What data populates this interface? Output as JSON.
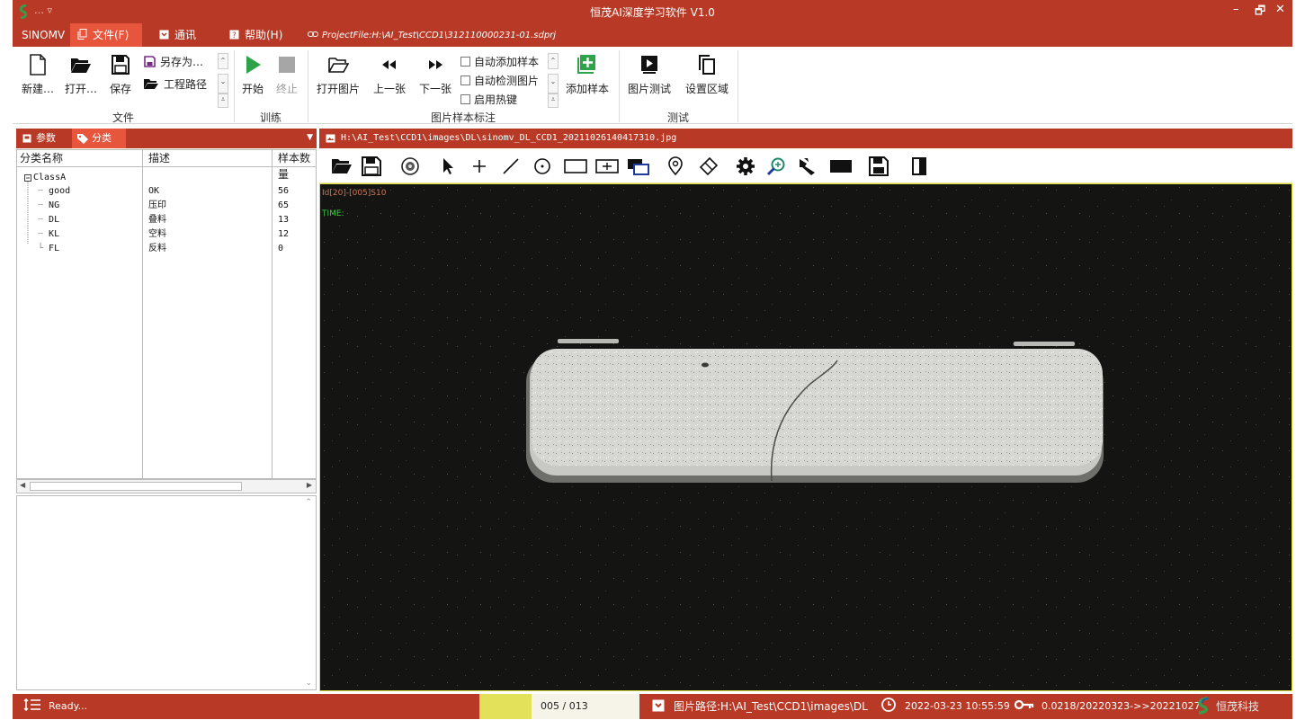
{
  "app": {
    "title": "恒茂AI深度学习软件 V1.0",
    "quick_access": "…   ▿",
    "window_controls": {
      "minimize": "–",
      "restore": "🗗",
      "close": "✕"
    }
  },
  "menu": {
    "brand": "SINOMV",
    "items": [
      {
        "label": "文件(F)",
        "icon": "copy-icon"
      },
      {
        "label": "通讯",
        "icon": "comm-icon"
      },
      {
        "label": "帮助(H)",
        "icon": "help-icon"
      }
    ],
    "project_file": "ProjectFile:H:\\AI_Test\\CCD1\\312110000231-01.sdprj"
  },
  "ribbon": {
    "file_group": {
      "label": "文件",
      "new": "新建…",
      "open": "打开…",
      "save": "保存",
      "save_as": "另存为…",
      "project_path": "工程路径"
    },
    "train_group": {
      "label": "训练",
      "start": "开始",
      "stop": "终止"
    },
    "annotate_group": {
      "label": "图片样本标注",
      "open_image": "打开图片",
      "prev": "上一张",
      "next": "下一张",
      "auto_add": "自动添加样本",
      "auto_detect": "自动检测图片",
      "hotkey": "启用热键",
      "add_sample": "添加样本"
    },
    "test_group": {
      "label": "测试",
      "image_test": "图片测试",
      "set_region": "设置区域"
    }
  },
  "left_panel": {
    "tabs": [
      {
        "label": "参数"
      },
      {
        "label": "分类"
      }
    ],
    "columns": [
      "分类名称",
      "描述",
      "样本数量"
    ],
    "root": "ClassA",
    "rows": [
      {
        "name": "good",
        "desc": "OK",
        "count": "56"
      },
      {
        "name": "NG",
        "desc": "压印",
        "count": "65"
      },
      {
        "name": "DL",
        "desc": "叠料",
        "count": "13"
      },
      {
        "name": "KL",
        "desc": "空料",
        "count": "12"
      },
      {
        "name": "FL",
        "desc": "反料",
        "count": "0"
      }
    ]
  },
  "viewer": {
    "path": "H:\\AI_Test\\CCD1\\images\\DL\\sinomv_DL_CCD1_20211026140417310.jpg",
    "overlay_id": "Id[20]-[005]S10",
    "overlay_time": "TIME:",
    "tools": [
      "open-folder-icon",
      "save-icon",
      "camera-icon",
      "pointer-icon",
      "crosshair-icon",
      "line-icon",
      "circle-icon",
      "rectangle-icon",
      "grid-rect-icon",
      "layers-icon",
      "location-icon",
      "eraser-icon",
      "gear-icon",
      "zoom-icon",
      "brush-icon",
      "fill-rect-icon",
      "save-disk-icon",
      "split-view-icon"
    ]
  },
  "status": {
    "ready": "Ready...",
    "page": "005 / 013",
    "image_path": "图片路径:H:\\AI_Test\\CCD1\\images\\DL",
    "datetime": "2022-03-23 10:55:59",
    "license": "0.0218/20220323->>20221027",
    "brand": "恒茂科技"
  },
  "colors": {
    "primary": "#b83a26",
    "active_tab": "#e7553d",
    "viewer_bg": "#141412",
    "play_green": "#2ea34a"
  }
}
